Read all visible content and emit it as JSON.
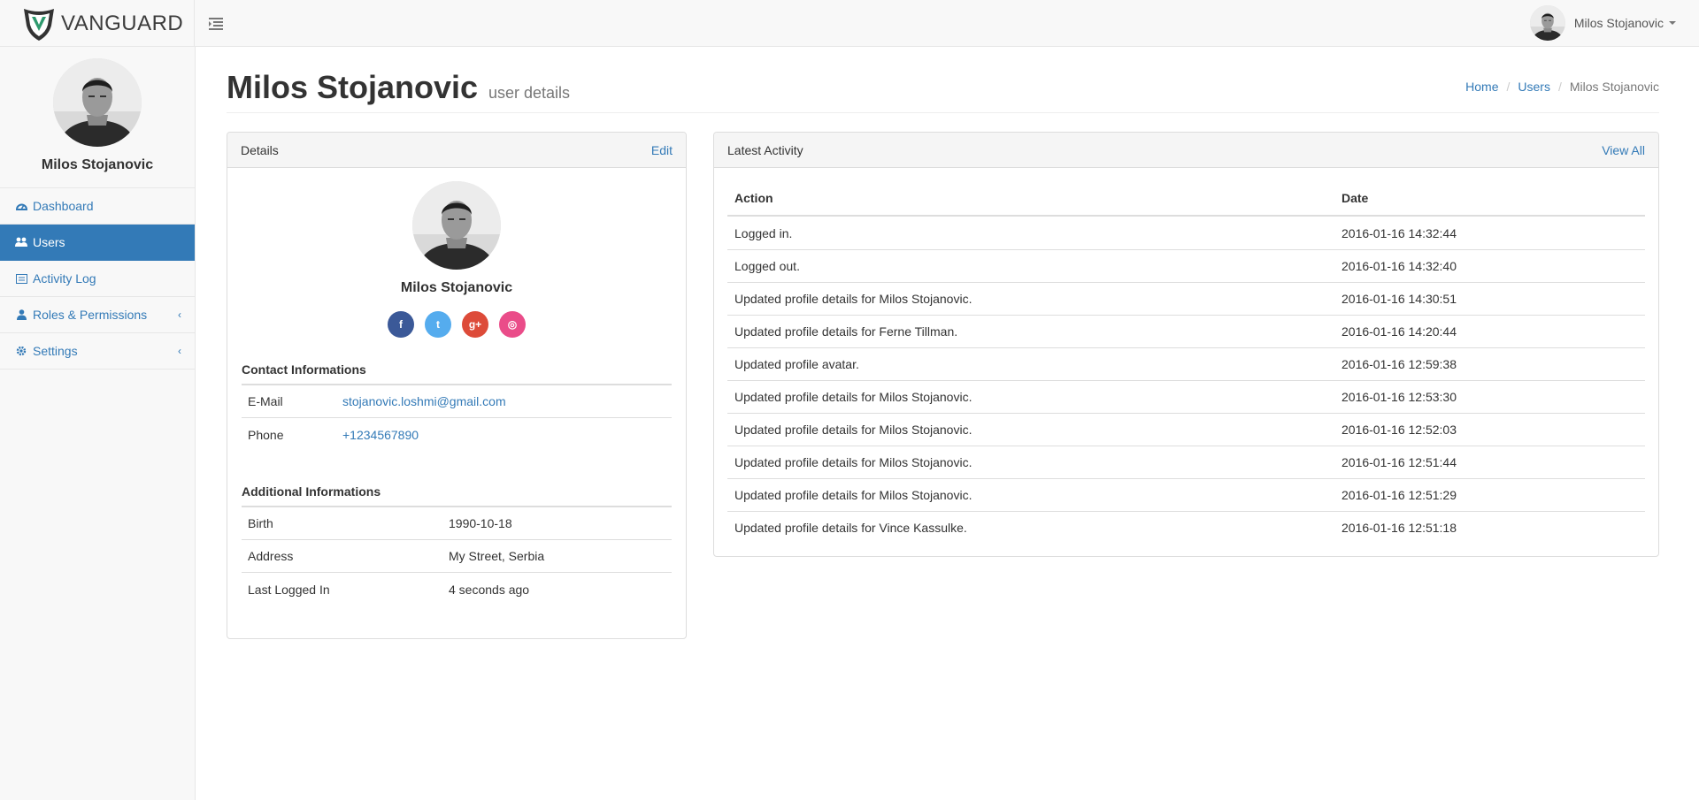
{
  "brand": {
    "name": "VANGUARD"
  },
  "user": {
    "name": "Milos Stojanovic"
  },
  "sidebar": {
    "profile_name": "Milos Stojanovic",
    "items": [
      {
        "label": "Dashboard",
        "icon": "dashboard-icon"
      },
      {
        "label": "Users",
        "icon": "users-icon",
        "active": true
      },
      {
        "label": "Activity Log",
        "icon": "activity-log-icon"
      },
      {
        "label": "Roles & Permissions",
        "icon": "user-icon",
        "has_submenu": true
      },
      {
        "label": "Settings",
        "icon": "gear-icon",
        "has_submenu": true
      }
    ]
  },
  "page": {
    "title": "Milos Stojanovic",
    "subtitle": "user details",
    "breadcrumb": [
      "Home",
      "Users",
      "Milos Stojanovic"
    ]
  },
  "details": {
    "panel_title": "Details",
    "edit_label": "Edit",
    "name": "Milos Stojanovic",
    "socials": [
      {
        "name": "facebook",
        "glyph": "f",
        "color": "#3b5998"
      },
      {
        "name": "twitter",
        "glyph": "t",
        "color": "#55acee"
      },
      {
        "name": "google-plus",
        "glyph": "g+",
        "color": "#dd4b39"
      },
      {
        "name": "dribbble",
        "glyph": "◎",
        "color": "#ea4c89"
      }
    ],
    "contact_title": "Contact Informations",
    "contact": [
      {
        "label": "E-Mail",
        "value": "stojanovic.loshmi@gmail.com"
      },
      {
        "label": "Phone",
        "value": "+1234567890"
      }
    ],
    "additional_title": "Additional Informations",
    "additional": [
      {
        "label": "Birth",
        "value": "1990-10-18"
      },
      {
        "label": "Address",
        "value": "My Street, Serbia"
      },
      {
        "label": "Last Logged In",
        "value": "4 seconds ago"
      }
    ]
  },
  "activity": {
    "panel_title": "Latest Activity",
    "view_all_label": "View All",
    "columns": [
      "Action",
      "Date"
    ],
    "rows": [
      {
        "action": "Logged in.",
        "date": "2016-01-16 14:32:44"
      },
      {
        "action": "Logged out.",
        "date": "2016-01-16 14:32:40"
      },
      {
        "action": "Updated profile details for Milos Stojanovic.",
        "date": "2016-01-16 14:30:51"
      },
      {
        "action": "Updated profile details for Ferne Tillman.",
        "date": "2016-01-16 14:20:44"
      },
      {
        "action": "Updated profile avatar.",
        "date": "2016-01-16 12:59:38"
      },
      {
        "action": "Updated profile details for Milos Stojanovic.",
        "date": "2016-01-16 12:53:30"
      },
      {
        "action": "Updated profile details for Milos Stojanovic.",
        "date": "2016-01-16 12:52:03"
      },
      {
        "action": "Updated profile details for Milos Stojanovic.",
        "date": "2016-01-16 12:51:44"
      },
      {
        "action": "Updated profile details for Milos Stojanovic.",
        "date": "2016-01-16 12:51:29"
      },
      {
        "action": "Updated profile details for Vince Kassulke.",
        "date": "2016-01-16 12:51:18"
      }
    ]
  },
  "colors": {
    "accent": "#337ab7",
    "logo_green": "#2e9a6e"
  }
}
